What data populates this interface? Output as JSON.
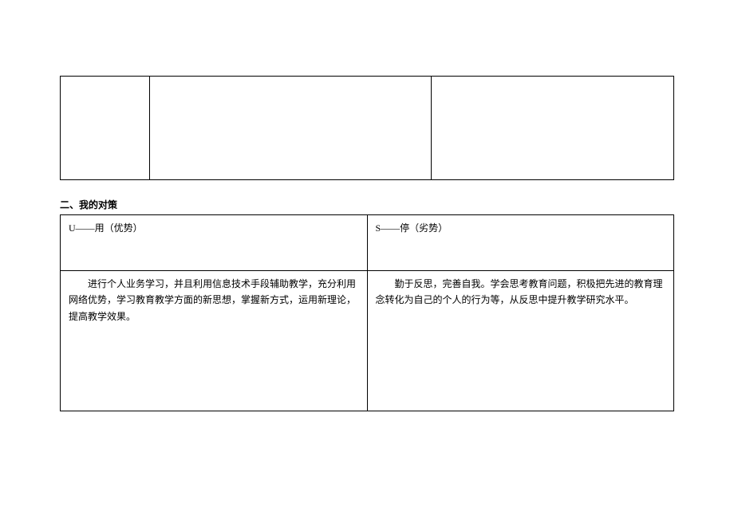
{
  "topTable": {
    "cells": [
      "",
      "",
      ""
    ]
  },
  "section2": {
    "title": "二、我的对策",
    "headers": {
      "left": "U——用（优势）",
      "right": "S——停（劣势）"
    },
    "content": {
      "left": "进行个人业务学习，并且利用信息技术手段辅助教学，充分利用网络优势，学习教育教学方面的新思想，掌握新方式，运用新理论，提高教学效果。",
      "right": "勤于反思，完善自我。学会思考教育问题，积极把先进的教育理念转化为自己的个人的行为等，从反思中提升教学研究水平。"
    }
  }
}
